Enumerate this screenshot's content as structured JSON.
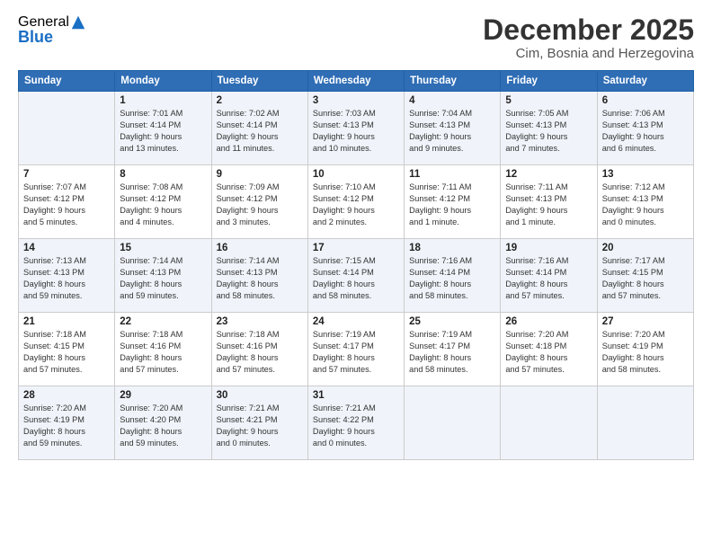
{
  "logo": {
    "general": "General",
    "blue": "Blue"
  },
  "title": "December 2025",
  "subtitle": "Cim, Bosnia and Herzegovina",
  "days_of_week": [
    "Sunday",
    "Monday",
    "Tuesday",
    "Wednesday",
    "Thursday",
    "Friday",
    "Saturday"
  ],
  "weeks": [
    [
      {
        "day": "",
        "info": ""
      },
      {
        "day": "1",
        "info": "Sunrise: 7:01 AM\nSunset: 4:14 PM\nDaylight: 9 hours\nand 13 minutes."
      },
      {
        "day": "2",
        "info": "Sunrise: 7:02 AM\nSunset: 4:14 PM\nDaylight: 9 hours\nand 11 minutes."
      },
      {
        "day": "3",
        "info": "Sunrise: 7:03 AM\nSunset: 4:13 PM\nDaylight: 9 hours\nand 10 minutes."
      },
      {
        "day": "4",
        "info": "Sunrise: 7:04 AM\nSunset: 4:13 PM\nDaylight: 9 hours\nand 9 minutes."
      },
      {
        "day": "5",
        "info": "Sunrise: 7:05 AM\nSunset: 4:13 PM\nDaylight: 9 hours\nand 7 minutes."
      },
      {
        "day": "6",
        "info": "Sunrise: 7:06 AM\nSunset: 4:13 PM\nDaylight: 9 hours\nand 6 minutes."
      }
    ],
    [
      {
        "day": "7",
        "info": "Sunrise: 7:07 AM\nSunset: 4:12 PM\nDaylight: 9 hours\nand 5 minutes."
      },
      {
        "day": "8",
        "info": "Sunrise: 7:08 AM\nSunset: 4:12 PM\nDaylight: 9 hours\nand 4 minutes."
      },
      {
        "day": "9",
        "info": "Sunrise: 7:09 AM\nSunset: 4:12 PM\nDaylight: 9 hours\nand 3 minutes."
      },
      {
        "day": "10",
        "info": "Sunrise: 7:10 AM\nSunset: 4:12 PM\nDaylight: 9 hours\nand 2 minutes."
      },
      {
        "day": "11",
        "info": "Sunrise: 7:11 AM\nSunset: 4:12 PM\nDaylight: 9 hours\nand 1 minute."
      },
      {
        "day": "12",
        "info": "Sunrise: 7:11 AM\nSunset: 4:13 PM\nDaylight: 9 hours\nand 1 minute."
      },
      {
        "day": "13",
        "info": "Sunrise: 7:12 AM\nSunset: 4:13 PM\nDaylight: 9 hours\nand 0 minutes."
      }
    ],
    [
      {
        "day": "14",
        "info": "Sunrise: 7:13 AM\nSunset: 4:13 PM\nDaylight: 8 hours\nand 59 minutes."
      },
      {
        "day": "15",
        "info": "Sunrise: 7:14 AM\nSunset: 4:13 PM\nDaylight: 8 hours\nand 59 minutes."
      },
      {
        "day": "16",
        "info": "Sunrise: 7:14 AM\nSunset: 4:13 PM\nDaylight: 8 hours\nand 58 minutes."
      },
      {
        "day": "17",
        "info": "Sunrise: 7:15 AM\nSunset: 4:14 PM\nDaylight: 8 hours\nand 58 minutes."
      },
      {
        "day": "18",
        "info": "Sunrise: 7:16 AM\nSunset: 4:14 PM\nDaylight: 8 hours\nand 58 minutes."
      },
      {
        "day": "19",
        "info": "Sunrise: 7:16 AM\nSunset: 4:14 PM\nDaylight: 8 hours\nand 57 minutes."
      },
      {
        "day": "20",
        "info": "Sunrise: 7:17 AM\nSunset: 4:15 PM\nDaylight: 8 hours\nand 57 minutes."
      }
    ],
    [
      {
        "day": "21",
        "info": "Sunrise: 7:18 AM\nSunset: 4:15 PM\nDaylight: 8 hours\nand 57 minutes."
      },
      {
        "day": "22",
        "info": "Sunrise: 7:18 AM\nSunset: 4:16 PM\nDaylight: 8 hours\nand 57 minutes."
      },
      {
        "day": "23",
        "info": "Sunrise: 7:18 AM\nSunset: 4:16 PM\nDaylight: 8 hours\nand 57 minutes."
      },
      {
        "day": "24",
        "info": "Sunrise: 7:19 AM\nSunset: 4:17 PM\nDaylight: 8 hours\nand 57 minutes."
      },
      {
        "day": "25",
        "info": "Sunrise: 7:19 AM\nSunset: 4:17 PM\nDaylight: 8 hours\nand 58 minutes."
      },
      {
        "day": "26",
        "info": "Sunrise: 7:20 AM\nSunset: 4:18 PM\nDaylight: 8 hours\nand 57 minutes."
      },
      {
        "day": "27",
        "info": "Sunrise: 7:20 AM\nSunset: 4:19 PM\nDaylight: 8 hours\nand 58 minutes."
      }
    ],
    [
      {
        "day": "28",
        "info": "Sunrise: 7:20 AM\nSunset: 4:19 PM\nDaylight: 8 hours\nand 59 minutes."
      },
      {
        "day": "29",
        "info": "Sunrise: 7:20 AM\nSunset: 4:20 PM\nDaylight: 8 hours\nand 59 minutes."
      },
      {
        "day": "30",
        "info": "Sunrise: 7:21 AM\nSunset: 4:21 PM\nDaylight: 9 hours\nand 0 minutes."
      },
      {
        "day": "31",
        "info": "Sunrise: 7:21 AM\nSunset: 4:22 PM\nDaylight: 9 hours\nand 0 minutes."
      },
      {
        "day": "",
        "info": ""
      },
      {
        "day": "",
        "info": ""
      },
      {
        "day": "",
        "info": ""
      }
    ]
  ]
}
